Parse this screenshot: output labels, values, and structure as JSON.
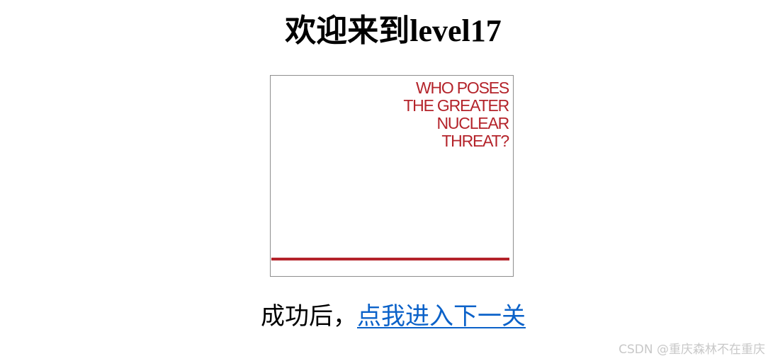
{
  "page": {
    "title_prefix": "欢迎来到",
    "title_level": "level17"
  },
  "embed": {
    "headline_lines": [
      "WHO POSES",
      "THE GREATER",
      "NUCLEAR",
      "THREAT?"
    ],
    "accent_color": "#b4232a"
  },
  "footer": {
    "prefix": "成功后，",
    "link_text": "点我进入下一关",
    "link_color": "#0b62c9"
  },
  "watermark": {
    "text": "CSDN @重庆森林不在重庆"
  }
}
